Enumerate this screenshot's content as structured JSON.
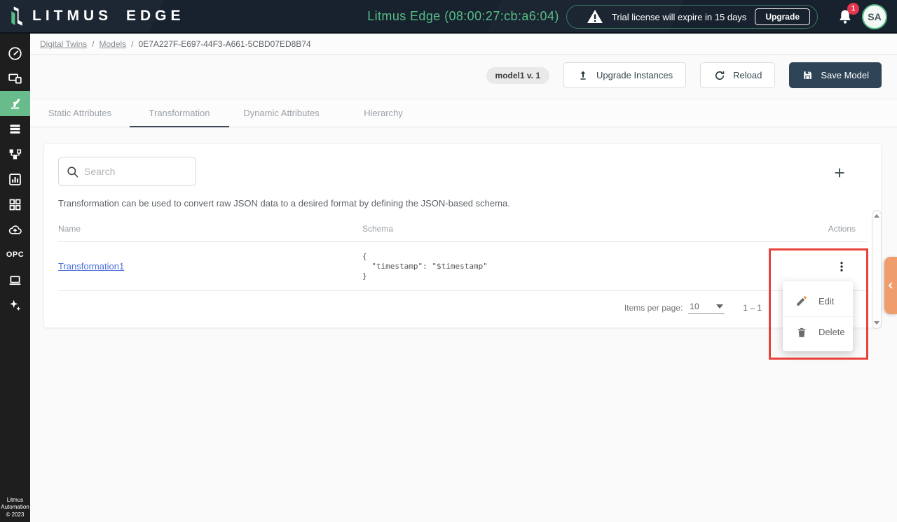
{
  "header": {
    "logo_text": "LITMUS EDGE",
    "title": "Litmus Edge (08:00:27:cb:a6:04)",
    "license_warning": "Trial license will expire in 15 days",
    "upgrade_label": "Upgrade",
    "notification_count": "1",
    "avatar_initials": "SA"
  },
  "sidebar": {
    "opc_label": "OPC",
    "footer_lines": [
      "Litmus",
      "Automation",
      "© 2023"
    ]
  },
  "breadcrumb": {
    "separator": "/",
    "items": [
      "Digital Twins",
      "Models",
      "0E7A227F-E697-44F3-A661-5CBD07ED8B74"
    ]
  },
  "toolbar": {
    "model_chip": "model1 v. 1",
    "upgrade_instances_label": "Upgrade Instances",
    "reload_label": "Reload",
    "save_model_label": "Save Model"
  },
  "tabs": [
    {
      "label": "Static Attributes",
      "active": false
    },
    {
      "label": "Transformation",
      "active": true
    },
    {
      "label": "Dynamic Attributes",
      "active": false
    },
    {
      "label": "Hierarchy",
      "active": false
    }
  ],
  "content": {
    "search_placeholder": "Search",
    "description": "Transformation can be used to convert raw JSON data to a desired format by defining the JSON-based schema.",
    "table": {
      "columns": [
        "Name",
        "Schema",
        "Actions"
      ],
      "rows": [
        {
          "name": "Transformation1",
          "schema": "{\n  \"timestamp\": \"$timestamp\"\n}"
        }
      ]
    },
    "pagination": {
      "items_per_page_label": "Items per page:",
      "items_per_page_value": "10",
      "range": "1 – 1"
    }
  },
  "menu": {
    "items": [
      {
        "label": "Edit"
      },
      {
        "label": "Delete"
      }
    ]
  },
  "icons": {
    "logo": "litmus-mark",
    "warning": "triangle-exclamation",
    "bell": "notification-bell",
    "search": "magnifier",
    "add": "plus",
    "kebab": "three-vertical-dots",
    "edit": "pencil",
    "delete": "trash-can",
    "upgrade_instances": "arrow-up-from-line",
    "reload": "circular-arrow",
    "save": "floppy-disk",
    "next_page": "chevron-right",
    "collapse_panel": "chevron-left"
  },
  "colors": {
    "header_bg": "#17222e",
    "accent_green": "#57bd86",
    "sidebar_active_green": "#68bc8b",
    "save_button": "#2f4557",
    "orange_tab": "#f09d6d",
    "highlight_red": "#e8433a",
    "link_blue": "#4a6fdc",
    "badge_red": "#e5364e"
  }
}
